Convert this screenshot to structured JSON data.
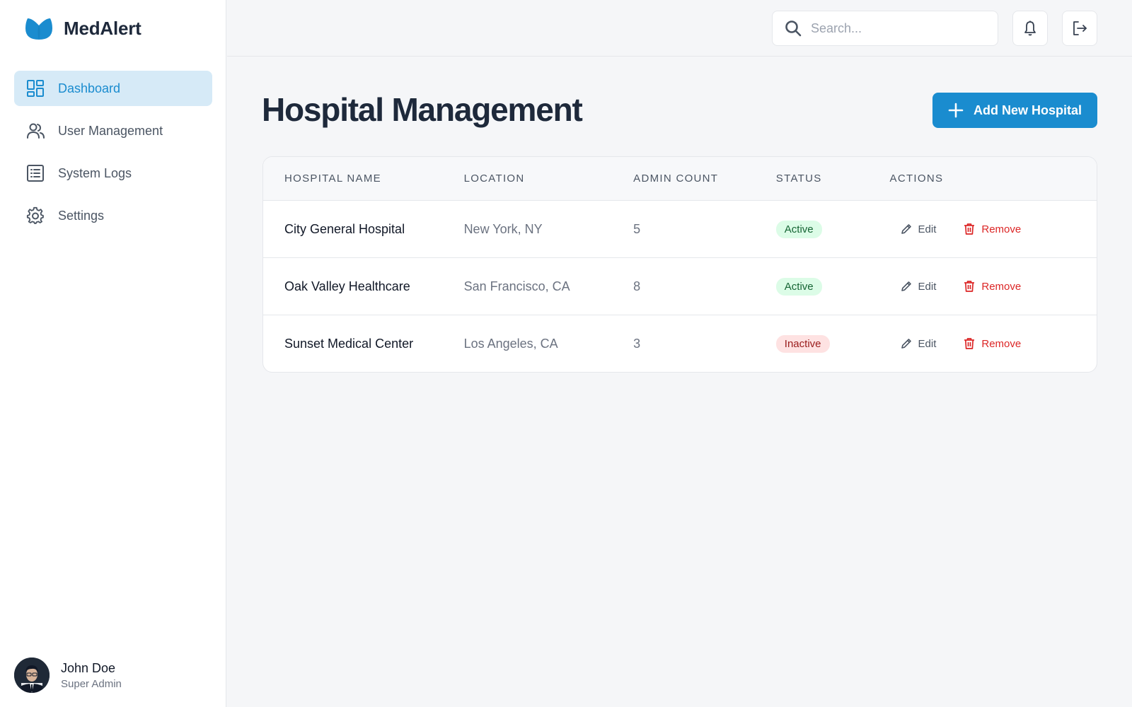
{
  "brand": {
    "name": "MedAlert"
  },
  "sidebar": {
    "items": [
      {
        "label": "Dashboard",
        "icon": "dashboard-icon",
        "active": true
      },
      {
        "label": "User Management",
        "icon": "users-icon",
        "active": false
      },
      {
        "label": "System Logs",
        "icon": "list-icon",
        "active": false
      },
      {
        "label": "Settings",
        "icon": "gear-icon",
        "active": false
      }
    ]
  },
  "user": {
    "name": "John Doe",
    "role": "Super Admin"
  },
  "header": {
    "search_placeholder": "Search...",
    "icons": [
      "search-icon",
      "bell-icon",
      "logout-icon"
    ]
  },
  "main": {
    "title": "Hospital Management",
    "add_button_label": "Add New Hospital",
    "table": {
      "columns": [
        "HOSPITAL NAME",
        "LOCATION",
        "ADMIN COUNT",
        "STATUS",
        "ACTIONS"
      ],
      "rows": [
        {
          "name": "City General Hospital",
          "location": "New York, NY",
          "admin_count": "5",
          "status": "Active"
        },
        {
          "name": "Oak Valley Healthcare",
          "location": "San Francisco, CA",
          "admin_count": "8",
          "status": "Active"
        },
        {
          "name": "Sunset Medical Center",
          "location": "Los Angeles, CA",
          "admin_count": "3",
          "status": "Inactive"
        }
      ],
      "edit_label": "Edit",
      "remove_label": "Remove"
    }
  },
  "colors": {
    "accent": "#1a8ccf",
    "active_nav_bg": "#d6eaf7",
    "status_active_bg": "#dcfce7",
    "status_active_text": "#166534",
    "status_inactive_bg": "#fee2e2",
    "status_inactive_text": "#991b1b",
    "remove_text": "#dc2626"
  }
}
